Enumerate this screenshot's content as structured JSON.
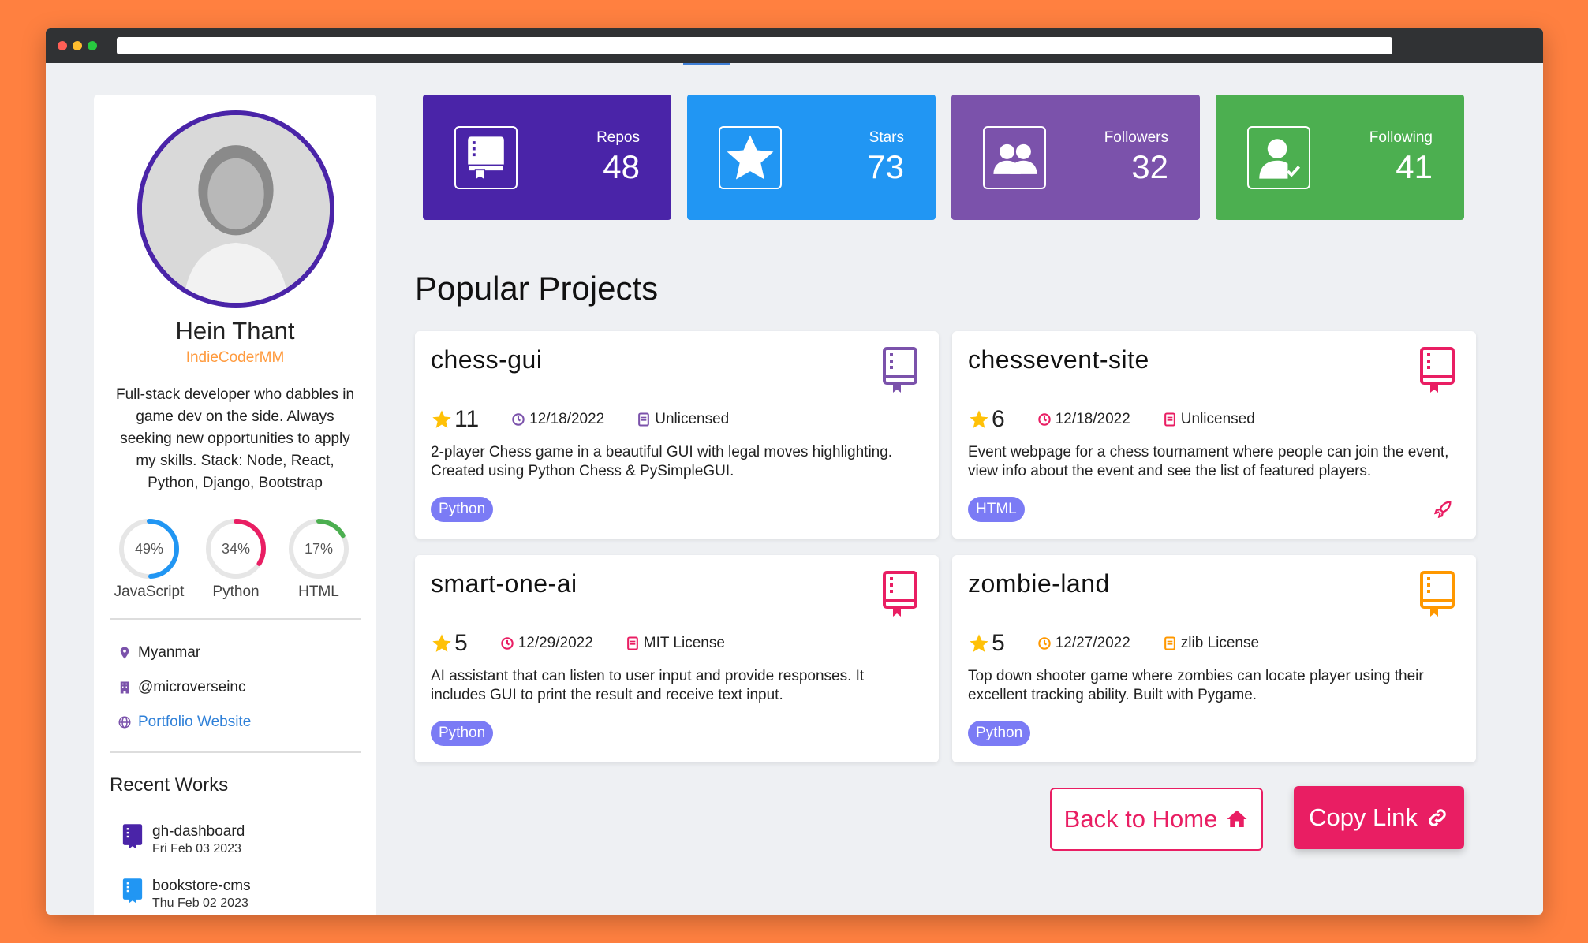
{
  "colors": {
    "accent": "#e91e63",
    "purple": "#4a24a8",
    "tag": "#7b7bf5"
  },
  "profile": {
    "name": "Hein Thant",
    "handle": "IndieCoderMM",
    "bio": "Full-stack developer who dabbles in game dev on the side. Always seeking new opportunities to apply my skills. Stack: Node, React, Python, Django, Bootstrap",
    "languages": [
      {
        "name": "JavaScript",
        "percent": "49%",
        "value": 49,
        "color": "#2196f3"
      },
      {
        "name": "Python",
        "percent": "34%",
        "value": 34,
        "color": "#e91e63"
      },
      {
        "name": "HTML",
        "percent": "17%",
        "value": 17,
        "color": "#4caf50"
      }
    ],
    "location": "Myanmar",
    "company": "@microverseinc",
    "website": "Portfolio Website"
  },
  "recent": {
    "title": "Recent Works",
    "items": [
      {
        "name": "gh-dashboard",
        "date": "Fri Feb 03 2023",
        "icon": "book-icon",
        "color": "#4a24a8"
      },
      {
        "name": "bookstore-cms",
        "date": "Thu Feb 02 2023",
        "icon": "book-icon",
        "color": "#2196f3"
      }
    ]
  },
  "stats": [
    {
      "label": "Repos",
      "value": "48",
      "icon": "repo-icon",
      "color": "#4a24a8"
    },
    {
      "label": "Stars",
      "value": "73",
      "icon": "star-icon",
      "color": "#2196f3"
    },
    {
      "label": "Followers",
      "value": "32",
      "icon": "users-icon",
      "color": "#7b52ab"
    },
    {
      "label": "Following",
      "value": "41",
      "icon": "user-check-icon",
      "color": "#4caf50"
    }
  ],
  "section_title": "Popular Projects",
  "projects": [
    {
      "name": "chess-gui",
      "stars": "11",
      "date": "12/18/2022",
      "license": "Unlicensed",
      "description": "2-player Chess game in a beautiful GUI with legal moves highlighting. Created using Python Chess & PySimpleGUI.",
      "tag": "Python",
      "icon_color": "#7b52ab"
    },
    {
      "name": "chessevent-site",
      "stars": "6",
      "date": "12/18/2022",
      "license": "Unlicensed",
      "description": "Event webpage for a chess tournament where people can join the event, view info about the event and see the list of featured players.",
      "tag": "HTML",
      "icon_color": "#e91e63"
    },
    {
      "name": "smart-one-ai",
      "stars": "5",
      "date": "12/29/2022",
      "license": "MIT License",
      "description": "AI assistant that can listen to user input and provide responses. It includes GUI to print the result and receive text input.",
      "tag": "Python",
      "icon_color": "#e91e63"
    },
    {
      "name": "zombie-land",
      "stars": "5",
      "date": "12/27/2022",
      "license": "zlib License",
      "description": "Top down shooter game where zombies can locate player using their excellent tracking ability. Built with Pygame.",
      "tag": "Python",
      "icon_color": "#ff9800"
    }
  ],
  "buttons": {
    "home": "Back to Home",
    "copy": "Copy Link"
  }
}
